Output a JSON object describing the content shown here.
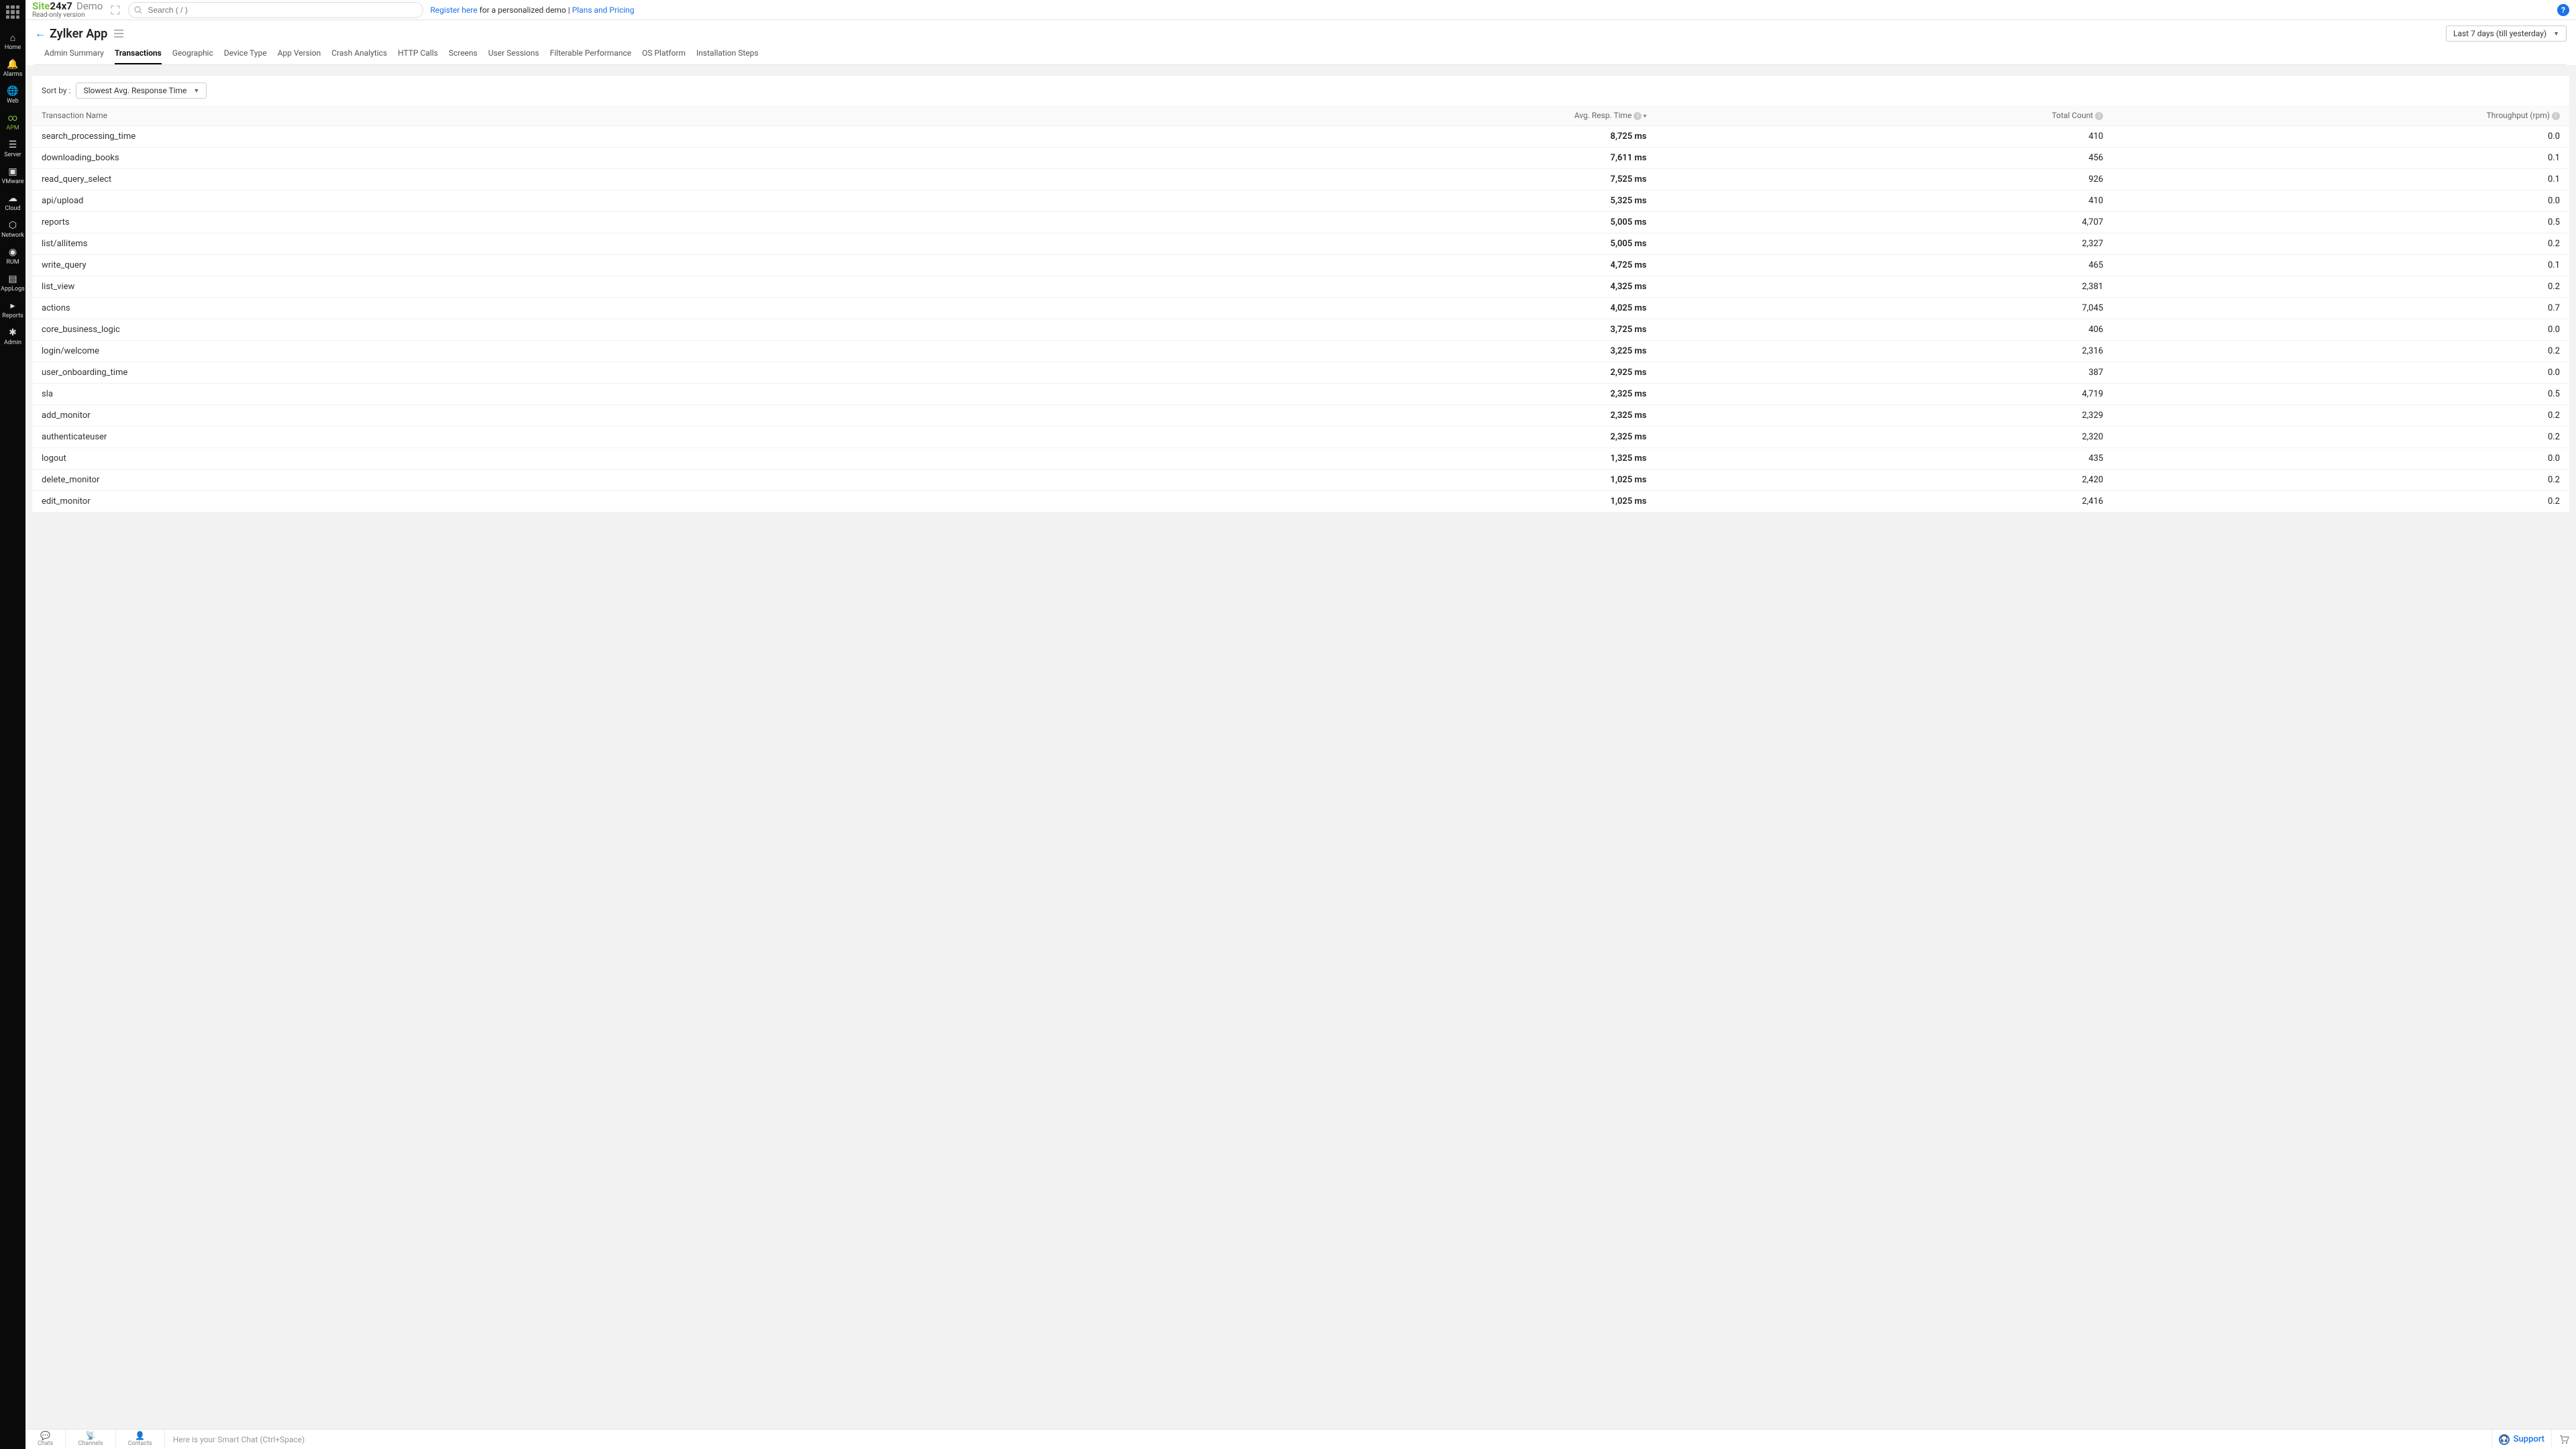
{
  "brand": {
    "site": "Site",
    "rest": "24x7",
    "demo": "Demo",
    "sub": "Read-only version"
  },
  "search": {
    "placeholder": "Search ( / )"
  },
  "promo": {
    "register": "Register here",
    "mid": " for a personalized demo | ",
    "plans": "Plans and Pricing"
  },
  "sidebar": [
    {
      "label": "Home"
    },
    {
      "label": "Alarms"
    },
    {
      "label": "Web"
    },
    {
      "label": "APM"
    },
    {
      "label": "Server"
    },
    {
      "label": "VMware"
    },
    {
      "label": "Cloud"
    },
    {
      "label": "Network"
    },
    {
      "label": "RUM"
    },
    {
      "label": "AppLogs"
    },
    {
      "label": "Reports"
    },
    {
      "label": "Admin"
    }
  ],
  "page": {
    "title": "Zylker App"
  },
  "period": {
    "label": "Last 7 days (till yesterday)"
  },
  "tabs": [
    "Admin Summary",
    "Transactions",
    "Geographic",
    "Device Type",
    "App Version",
    "Crash Analytics",
    "HTTP Calls",
    "Screens",
    "User Sessions",
    "Filterable Performance",
    "OS Platform",
    "Installation Steps"
  ],
  "activeTab": 1,
  "sort": {
    "label": "Sort by :",
    "value": "Slowest Avg. Response Time"
  },
  "columns": {
    "name": "Transaction Name",
    "resp": "Avg. Resp. Time",
    "count": "Total Count",
    "thr": "Throughput (rpm)"
  },
  "rows": [
    {
      "name": "search_processing_time",
      "resp": "8,725 ms",
      "count": "410",
      "thr": "0.0"
    },
    {
      "name": "downloading_books",
      "resp": "7,611 ms",
      "count": "456",
      "thr": "0.1"
    },
    {
      "name": "read_query_select",
      "resp": "7,525 ms",
      "count": "926",
      "thr": "0.1"
    },
    {
      "name": "api/upload",
      "resp": "5,325 ms",
      "count": "410",
      "thr": "0.0"
    },
    {
      "name": "reports",
      "resp": "5,005 ms",
      "count": "4,707",
      "thr": "0.5"
    },
    {
      "name": "list/allitems",
      "resp": "5,005 ms",
      "count": "2,327",
      "thr": "0.2"
    },
    {
      "name": "write_query",
      "resp": "4,725 ms",
      "count": "465",
      "thr": "0.1"
    },
    {
      "name": "list_view",
      "resp": "4,325 ms",
      "count": "2,381",
      "thr": "0.2"
    },
    {
      "name": "actions",
      "resp": "4,025 ms",
      "count": "7,045",
      "thr": "0.7"
    },
    {
      "name": "core_business_logic",
      "resp": "3,725 ms",
      "count": "406",
      "thr": "0.0"
    },
    {
      "name": "login/welcome",
      "resp": "3,225 ms",
      "count": "2,316",
      "thr": "0.2"
    },
    {
      "name": "user_onboarding_time",
      "resp": "2,925 ms",
      "count": "387",
      "thr": "0.0"
    },
    {
      "name": "sla",
      "resp": "2,325 ms",
      "count": "4,719",
      "thr": "0.5"
    },
    {
      "name": "add_monitor",
      "resp": "2,325 ms",
      "count": "2,329",
      "thr": "0.2"
    },
    {
      "name": "authenticateuser",
      "resp": "2,325 ms",
      "count": "2,320",
      "thr": "0.2"
    },
    {
      "name": "logout",
      "resp": "1,325 ms",
      "count": "435",
      "thr": "0.0"
    },
    {
      "name": "delete_monitor",
      "resp": "1,025 ms",
      "count": "2,420",
      "thr": "0.2"
    },
    {
      "name": "edit_monitor",
      "resp": "1,025 ms",
      "count": "2,416",
      "thr": "0.2"
    }
  ],
  "bottom": {
    "items": [
      "Chats",
      "Channels",
      "Contacts"
    ],
    "chatPlaceholder": "Here is your Smart Chat (Ctrl+Space)",
    "support": "Support"
  }
}
